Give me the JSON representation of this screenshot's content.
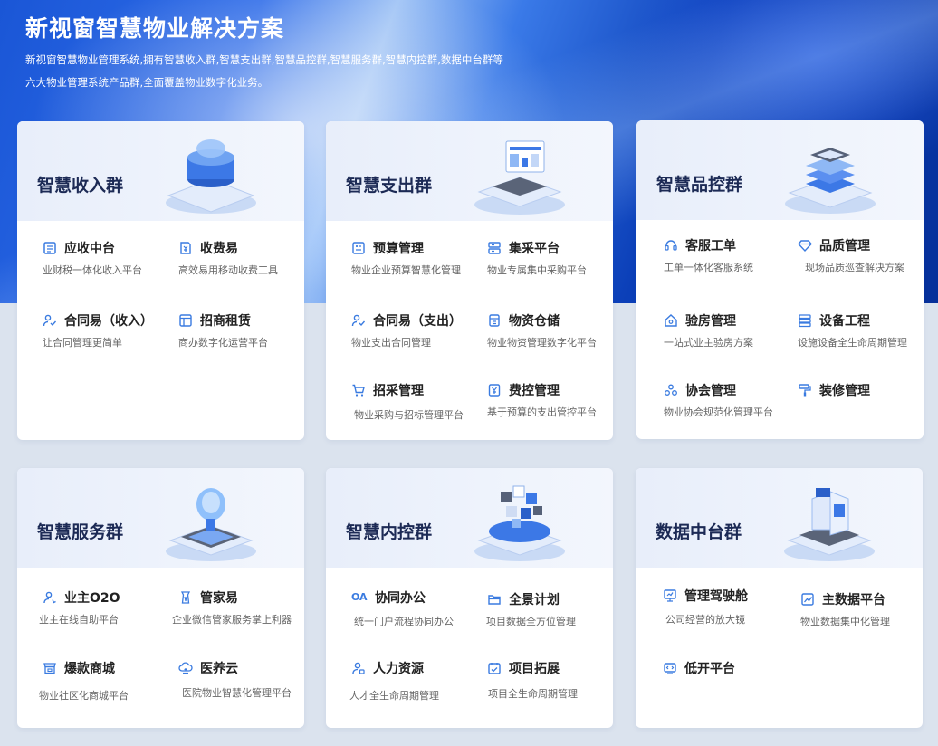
{
  "hero": {
    "title": "新视窗智慧物业解决方案",
    "desc_line1": "新视窗智慧物业管理系统,拥有智慧收入群,智慧支出群,智慧品控群,智慧服务群,智慧内控群,数据中台群等",
    "desc_line2": "六大物业管理系统产品群,全面覆盖物业数字化业务。"
  },
  "colors": {
    "accent": "#3a7be0",
    "title": "#1c2a55"
  },
  "cards": [
    {
      "title": "智慧收入群",
      "items": [
        {
          "name": "应收中台",
          "desc": "业财税一体化收入平台",
          "icon": "document-list-icon"
        },
        {
          "name": "收费易",
          "desc": "高效易用移动收费工具",
          "icon": "currency-icon"
        },
        {
          "name": "合同易（收入）",
          "desc": "让合同管理更简单",
          "icon": "person-contract-icon"
        },
        {
          "name": "招商租赁",
          "desc": "商办数字化运营平台",
          "icon": "window-icon"
        }
      ]
    },
    {
      "title": "智慧支出群",
      "items": [
        {
          "name": "预算管理",
          "desc": "物业企业预算智慧化管理",
          "icon": "budget-icon"
        },
        {
          "name": "集采平台",
          "desc": "物业专属集中采购平台",
          "icon": "server-icon"
        },
        {
          "name": "合同易（支出）",
          "desc": "物业支出合同管理",
          "icon": "person-contract-icon"
        },
        {
          "name": "物资仓储",
          "desc": "物业物资管理数字化平台",
          "icon": "storage-icon"
        },
        {
          "name": "招采管理",
          "desc": "物业采购与招标管理平台",
          "icon": "cart-icon"
        },
        {
          "name": "费控管理",
          "desc": "基于预算的支出管控平台",
          "icon": "expense-icon"
        }
      ]
    },
    {
      "title": "智慧品控群",
      "items": [
        {
          "name": "客服工单",
          "desc": "工单一体化客服系统",
          "icon": "headset-icon"
        },
        {
          "name": "品质管理",
          "desc": "现场品质巡查解决方案",
          "icon": "diamond-icon"
        },
        {
          "name": "验房管理",
          "desc": "一站式业主验房方案",
          "icon": "house-icon"
        },
        {
          "name": "设备工程",
          "desc": "设施设备全生命周期管理",
          "icon": "equipment-icon"
        },
        {
          "name": "协会管理",
          "desc": "物业协会规范化管理平台",
          "icon": "group-icon"
        },
        {
          "name": "装修管理",
          "desc": "",
          "icon": "paint-roller-icon"
        }
      ]
    },
    {
      "title": "智慧服务群",
      "items": [
        {
          "name": "业主O2O",
          "desc": "业主在线自助平台",
          "icon": "owner-icon"
        },
        {
          "name": "管家易",
          "desc": "企业微信管家服务掌上利器",
          "icon": "butler-icon"
        },
        {
          "name": "爆款商城",
          "desc": "物业社区化商城平台",
          "icon": "shop-icon"
        },
        {
          "name": "医养云",
          "desc": "医院物业智慧化管理平台",
          "icon": "cloud-icon"
        }
      ]
    },
    {
      "title": "智慧内控群",
      "items": [
        {
          "name": "协同办公",
          "desc": "统一门户流程协同办公",
          "icon": "oa-icon",
          "icon_text": "OA"
        },
        {
          "name": "全景计划",
          "desc": "项目数据全方位管理",
          "icon": "folder-icon"
        },
        {
          "name": "人力资源",
          "desc": "人才全生命周期管理",
          "icon": "hr-icon"
        },
        {
          "name": "项目拓展",
          "desc": "项目全生命周期管理",
          "icon": "project-icon"
        }
      ]
    },
    {
      "title": "数据中台群",
      "items": [
        {
          "name": "管理驾驶舱",
          "desc": "公司经营的放大镜",
          "icon": "dashboard-icon"
        },
        {
          "name": "主数据平台",
          "desc": "物业数据集中化管理",
          "icon": "chart-icon"
        },
        {
          "name": "低开平台",
          "desc": "",
          "icon": "code-icon"
        }
      ]
    }
  ]
}
